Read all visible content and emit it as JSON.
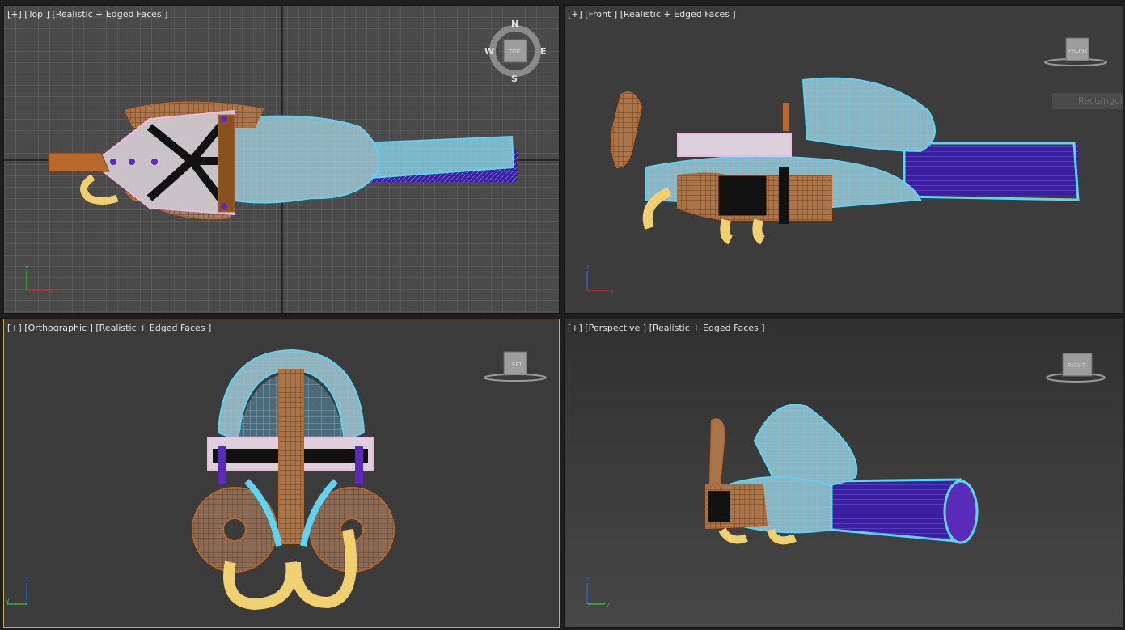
{
  "viewports": {
    "top": {
      "label": "[+] [Top ] [Realistic + Edged Faces ]",
      "cube": "TOP",
      "compass": {
        "n": "N",
        "s": "S",
        "e": "E",
        "w": "W"
      },
      "axes": {
        "a": "y",
        "b": "x"
      }
    },
    "front": {
      "label": "[+] [Front ] [Realistic + Edged Faces ]",
      "cube": "FRONT",
      "tooltip": "Rectangul",
      "axes": {
        "a": "z",
        "b": "x"
      }
    },
    "ortho": {
      "label": "[+] [Orthographic ] [Realistic + Edged Faces ]",
      "cube": "LEFT",
      "axes": {
        "a": "z",
        "b": "y"
      }
    },
    "persp": {
      "label": "[+] [Perspective ] [Realistic + Edged Faces ]",
      "cube": "RIGHT",
      "axes": {
        "a": "z",
        "b": "y"
      }
    }
  },
  "colors": {
    "wire_cyan": "#5fd3f0",
    "wire_orange": "#b8692e",
    "wire_purple": "#5a2ab8",
    "wire_pink": "#f0b8e0",
    "wire_yellow": "#f0d070",
    "active_border": "#c7a96a"
  },
  "icons": [
    "viewcube-icon",
    "compass-icon",
    "axis-gizmo-icon"
  ]
}
